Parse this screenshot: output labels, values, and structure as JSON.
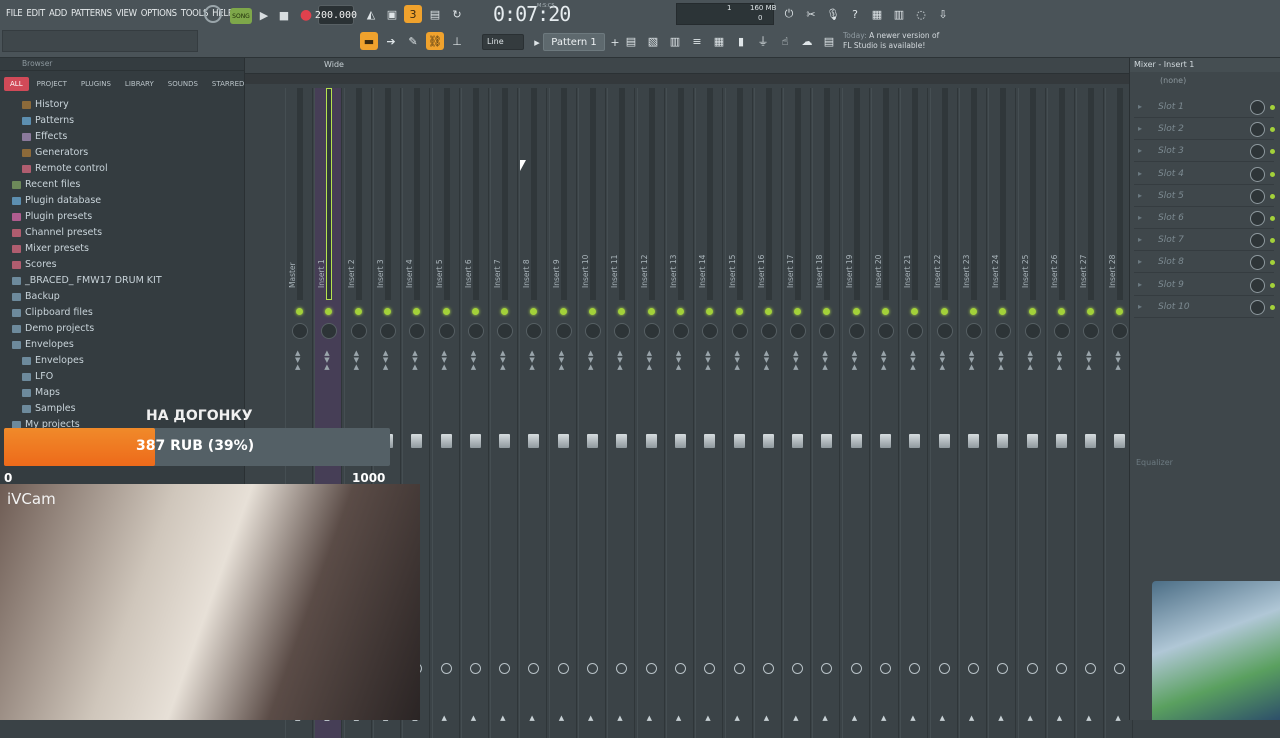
{
  "menu": [
    "FILE",
    "EDIT",
    "ADD",
    "PATTERNS",
    "VIEW",
    "OPTIONS",
    "TOOLS",
    "HELP"
  ],
  "transport": {
    "song_label": "SONG",
    "tempo": "200.000",
    "time": "0:07:20",
    "time_unit": "M:S:CS",
    "cpu": "1",
    "memory": "160 MB",
    "memory_val": "0"
  },
  "toolbar": {
    "pattern": "Pattern 1",
    "line_mode": "Line",
    "news_line1": "Today:",
    "news_line2": "A newer version of",
    "news_line3": "FL Studio is available!"
  },
  "browser": {
    "title": "Browser",
    "tabs": [
      "ALL",
      "PROJECT",
      "PLUGINS",
      "LIBRARY",
      "SOUNDS",
      "STARRED"
    ],
    "items": [
      {
        "label": "History",
        "indent": 2,
        "color": "#8c6a3a"
      },
      {
        "label": "Patterns",
        "indent": 2,
        "color": "#5d8fb0"
      },
      {
        "label": "Effects",
        "indent": 2,
        "color": "#8b7a9c"
      },
      {
        "label": "Generators",
        "indent": 2,
        "color": "#8c6a3a"
      },
      {
        "label": "Remote control",
        "indent": 2,
        "color": "#b05d6f"
      },
      {
        "label": "Recent files",
        "indent": 1,
        "color": "#6d8a5a"
      },
      {
        "label": "Plugin database",
        "indent": 1,
        "color": "#5d8fb0"
      },
      {
        "label": "Plugin presets",
        "indent": 1,
        "color": "#b05d8f"
      },
      {
        "label": "Channel presets",
        "indent": 1,
        "color": "#b05d6f"
      },
      {
        "label": "Mixer presets",
        "indent": 1,
        "color": "#b05d6f"
      },
      {
        "label": "Scores",
        "indent": 1,
        "color": "#b05d6f"
      },
      {
        "label": "_BRACED_ FMW17 DRUM KIT",
        "indent": 1,
        "color": "#6d8a9c"
      },
      {
        "label": "Backup",
        "indent": 1,
        "color": "#6d8a9c"
      },
      {
        "label": "Clipboard files",
        "indent": 1,
        "color": "#6d8a9c"
      },
      {
        "label": "Demo projects",
        "indent": 1,
        "color": "#6d8a9c"
      },
      {
        "label": "Envelopes",
        "indent": 1,
        "color": "#6d8a9c"
      },
      {
        "label": "Envelopes",
        "indent": 2,
        "color": "#6d8a9c"
      },
      {
        "label": "LFO",
        "indent": 2,
        "color": "#6d8a9c"
      },
      {
        "label": "Maps",
        "indent": 2,
        "color": "#6d8a9c"
      },
      {
        "label": "Samples",
        "indent": 2,
        "color": "#6d8a9c"
      },
      {
        "label": "My projects",
        "indent": 1,
        "color": "#6d8a9c"
      }
    ]
  },
  "mixer": {
    "view": "Wide",
    "strips": [
      "Master",
      "Insert 1",
      "Insert 2",
      "Insert 3",
      "Insert 4",
      "Insert 5",
      "Insert 6",
      "Insert 7",
      "Insert 8",
      "Insert 9",
      "Insert 10",
      "Insert 11",
      "Insert 12",
      "Insert 13",
      "Insert 14",
      "Insert 15",
      "Insert 16",
      "Insert 17",
      "Insert 18",
      "Insert 19",
      "Insert 20",
      "Insert 21",
      "Insert 22",
      "Insert 23",
      "Insert 24",
      "Insert 25",
      "Insert 26",
      "Insert 27",
      "Insert 28"
    ],
    "selected_index": 1
  },
  "insert_panel": {
    "title": "Mixer - Insert 1",
    "preset": "(none)",
    "slots": [
      "Slot 1",
      "Slot 2",
      "Slot 3",
      "Slot 4",
      "Slot 5",
      "Slot 6",
      "Slot 7",
      "Slot 8",
      "Slot 9",
      "Slot 10"
    ],
    "eq_label": "Equalizer"
  },
  "overlay": {
    "goal_title": "НА ДОГОНКУ",
    "goal_text": "387 RUB (39%)",
    "goal_progress": 0.39,
    "goal_min": "0",
    "goal_max": "1000",
    "cam_label": "iVCam"
  },
  "colors": {
    "accent": "#a3d13a",
    "goal_fill": "#ee6a1a",
    "tab_active": "#d04a58"
  }
}
